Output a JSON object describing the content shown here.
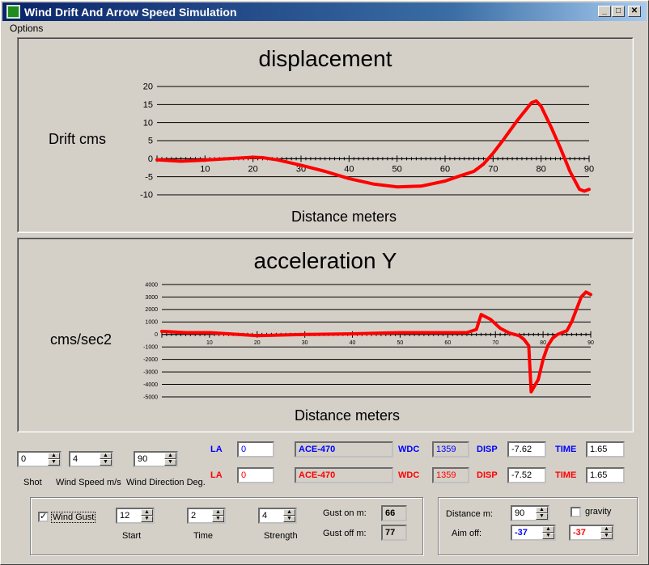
{
  "window": {
    "title": "Wind Drift And Arrow Speed Simulation",
    "minimize_glyph": "_",
    "maximize_glyph": "□",
    "close_glyph": "✕"
  },
  "menu": {
    "options": "Options"
  },
  "colors": {
    "series": "#ff0000",
    "blue_text": "#0000ff",
    "red_text": "#ff0000"
  },
  "chart_data": [
    {
      "type": "line",
      "title": "displacement",
      "ylabel": "Drift cms",
      "xlabel": "Distance meters",
      "xlim": [
        0,
        90
      ],
      "ylim": [
        -10,
        20
      ],
      "x_ticks": [
        10,
        20,
        30,
        40,
        50,
        60,
        70,
        80,
        90
      ],
      "y_ticks": [
        20,
        15,
        10,
        5,
        0,
        -5,
        -10
      ],
      "x_tick_labels": [
        "10",
        "20",
        "30",
        "40",
        "50",
        "60",
        "70",
        "80",
        "90"
      ],
      "y_tick_labels": [
        "20",
        "15",
        "10",
        "5",
        "0",
        "-5",
        "-10"
      ],
      "series": [
        {
          "color": "#ff0000",
          "x": [
            0,
            5,
            10,
            15,
            20,
            22,
            25,
            30,
            35,
            40,
            45,
            50,
            55,
            60,
            63,
            66,
            68,
            70,
            72,
            75,
            78,
            79,
            80,
            82,
            84,
            86,
            88,
            89,
            90
          ],
          "y": [
            -0.3,
            -0.7,
            -0.4,
            0,
            0.4,
            0.3,
            -0.3,
            -1.8,
            -3.5,
            -5.5,
            -7,
            -7.8,
            -7.6,
            -6.2,
            -4.8,
            -3.5,
            -1.5,
            1.5,
            5,
            10.5,
            15.5,
            16,
            14.5,
            9,
            3,
            -3.5,
            -8.5,
            -9,
            -8.5
          ]
        }
      ]
    },
    {
      "type": "line",
      "title": "acceleration Y",
      "ylabel": "cms/sec2",
      "xlabel": "Distance meters",
      "xlim": [
        0,
        90
      ],
      "ylim": [
        -5000,
        4000
      ],
      "x_ticks": [
        10,
        20,
        30,
        40,
        50,
        60,
        70,
        80,
        90
      ],
      "y_ticks": [
        4000,
        3000,
        2000,
        1000,
        0,
        -1000,
        -2000,
        -3000,
        -4000,
        -5000
      ],
      "x_tick_labels": [
        "10",
        "20",
        "30",
        "40",
        "50",
        "60",
        "70",
        "80",
        "90"
      ],
      "y_tick_labels": [
        "4000",
        "3000",
        "2000",
        "1000",
        "0",
        "-1000",
        "-2000",
        "-3000",
        "-4000",
        "-5000"
      ],
      "series": [
        {
          "color": "#ff0000",
          "x": [
            0,
            5,
            10,
            20,
            30,
            40,
            50,
            60,
            64,
            66,
            67,
            69,
            71,
            73,
            75,
            76,
            77,
            77.5,
            79,
            80,
            81,
            82,
            83,
            85,
            86,
            87,
            88,
            89,
            90
          ],
          "y": [
            250,
            150,
            150,
            -100,
            0,
            50,
            150,
            150,
            150,
            400,
            1600,
            1200,
            500,
            100,
            -100,
            -400,
            -900,
            -4600,
            -3600,
            -2000,
            -900,
            -300,
            0,
            300,
            1000,
            2000,
            3000,
            3400,
            3200
          ]
        }
      ]
    }
  ],
  "controls": {
    "shot": {
      "value": "0",
      "label": "Shot"
    },
    "wind_speed": {
      "value": "4",
      "label": "Wind Speed m/s"
    },
    "wind_direction": {
      "value": "90",
      "label": "Wind Direction Deg."
    },
    "row1": {
      "la_label": "LA",
      "la_value": "0",
      "model": "ACE-470",
      "wdc_label": "WDC",
      "wdc_value": "1359",
      "disp_label": "DISP",
      "disp_value": "-7.62",
      "time_label": "TIME",
      "time_value": "1.65"
    },
    "row2": {
      "la_label": "LA",
      "la_value": "0",
      "model": "ACE-470",
      "wdc_label": "WDC",
      "wdc_value": "1359",
      "disp_label": "DISP",
      "disp_value": "-7.52",
      "time_label": "TIME",
      "time_value": "1.65"
    },
    "gust": {
      "checkbox_label": "Wind Gust",
      "checked": true,
      "check_glyph": "✓",
      "start": {
        "value": "12",
        "label": "Start"
      },
      "time": {
        "value": "2",
        "label": "Time"
      },
      "strength": {
        "value": "4",
        "label": "Strength"
      },
      "gust_on_label": "Gust on m:",
      "gust_on_value": "66",
      "gust_off_label": "Gust off m:",
      "gust_off_value": "77"
    },
    "distance": {
      "label": "Distance m:",
      "value": "90",
      "gravity_label": "gravity",
      "gravity_checked": false,
      "aim_off_label": "Aim off:",
      "aim_off_blue": "-37",
      "aim_off_red": "-37"
    }
  }
}
